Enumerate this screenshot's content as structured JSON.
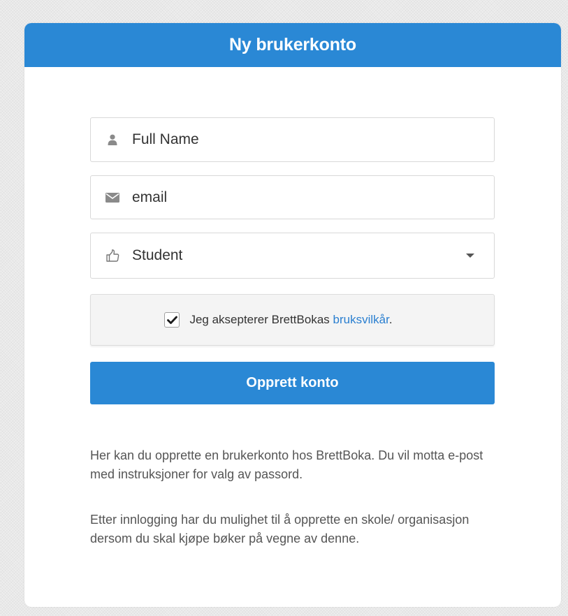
{
  "header": {
    "title": "Ny brukerkonto"
  },
  "form": {
    "full_name": {
      "placeholder": "Full Name",
      "value": "",
      "icon": "user-icon"
    },
    "email": {
      "placeholder": "email",
      "value": "",
      "icon": "envelope-icon"
    },
    "role": {
      "selected": "Student",
      "icon": "thumbs-up-icon"
    },
    "terms": {
      "checked": true,
      "text_before": "Jeg aksepterer BrettBokas ",
      "link_text": "bruksvilkår",
      "text_after": "."
    },
    "submit_label": "Opprett konto"
  },
  "info": {
    "paragraph_1": "Her kan du opprette en brukerkonto hos BrettBoka. Du vil motta e-post med instruksjoner for valg av passord.",
    "paragraph_2": "Etter innlogging har du mulighet til å opprette en skole/ organisasjon dersom du skal kjøpe bøker på vegne av denne."
  },
  "colors": {
    "accent": "#2a88d5",
    "link": "#2a7fd0",
    "text": "#333333",
    "muted_text": "#555555"
  }
}
